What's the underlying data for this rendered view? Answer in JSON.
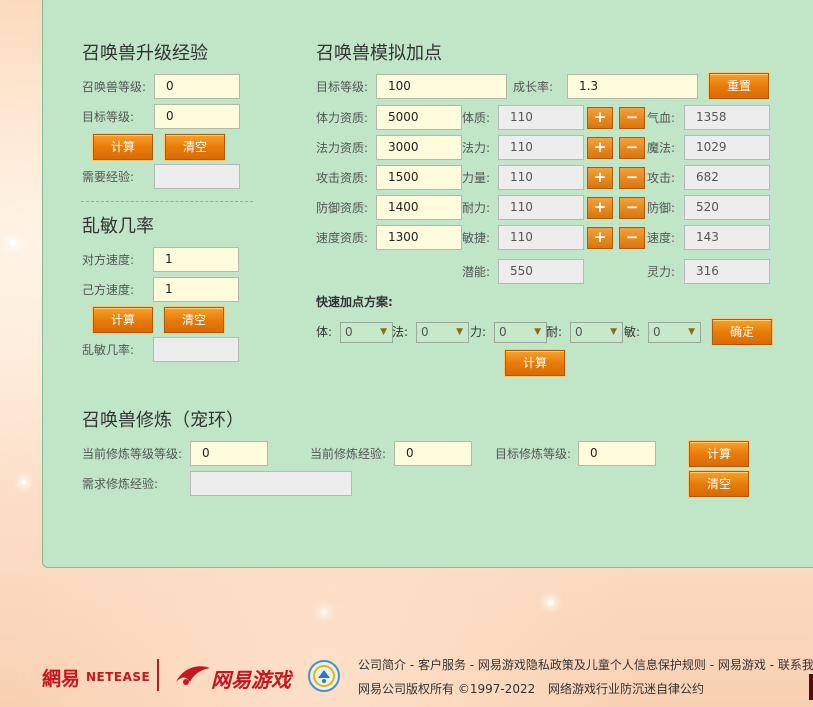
{
  "upgrade": {
    "title": "召唤兽升级经验",
    "cur_level_label": "召唤兽等级:",
    "cur_level_value": "0",
    "target_level_label": "目标等级:",
    "target_level_value": "0",
    "calc_label": "计算",
    "clear_label": "清空",
    "need_exp_label": "需要经验:"
  },
  "speed": {
    "title": "乱敏几率",
    "enemy_label": "对方速度:",
    "enemy_value": "1",
    "own_label": "己方速度:",
    "own_value": "1",
    "calc_label": "计算",
    "clear_label": "清空",
    "rate_label": "乱敏几率:"
  },
  "sim": {
    "title": "召唤兽模拟加点",
    "target_level_label": "目标等级:",
    "target_level_value": "100",
    "growth_label": "成长率:",
    "growth_value": "1.3",
    "reset_label": "重置",
    "rows": [
      {
        "apt_label": "体力资质:",
        "apt_value": "5000",
        "attr_label": "体质:",
        "attr_value": "110",
        "res_label": "气血:",
        "res_value": "1358"
      },
      {
        "apt_label": "法力资质:",
        "apt_value": "3000",
        "attr_label": "法力:",
        "attr_value": "110",
        "res_label": "魔法:",
        "res_value": "1029"
      },
      {
        "apt_label": "攻击资质:",
        "apt_value": "1500",
        "attr_label": "力量:",
        "attr_value": "110",
        "res_label": "攻击:",
        "res_value": "682"
      },
      {
        "apt_label": "防御资质:",
        "apt_value": "1400",
        "attr_label": "耐力:",
        "attr_value": "110",
        "res_label": "防御:",
        "res_value": "520"
      },
      {
        "apt_label": "速度资质:",
        "apt_value": "1300",
        "attr_label": "敏捷:",
        "attr_value": "110",
        "res_label": "速度:",
        "res_value": "143"
      }
    ],
    "plus": "+",
    "minus": "−",
    "potential_label": "潜能:",
    "potential_value": "550",
    "spirit_label": "灵力:",
    "spirit_value": "316",
    "quick_title": "快速加点方案:",
    "quick": [
      {
        "label": "体:",
        "value": "0"
      },
      {
        "label": "法:",
        "value": "0"
      },
      {
        "label": "力:",
        "value": "0"
      },
      {
        "label": "耐:",
        "value": "0"
      },
      {
        "label": "敏:",
        "value": "0"
      }
    ],
    "confirm_label": "确定",
    "calc_label": "计算"
  },
  "train": {
    "title": "召唤兽修炼（宠环）",
    "cur_level_label": "当前修炼等级等级:",
    "cur_level_value": "0",
    "cur_exp_label": "当前修炼经验:",
    "cur_exp_value": "0",
    "target_label": "目标修炼等级:",
    "target_value": "0",
    "calc_label": "计算",
    "clear_label": "清空",
    "need_label": "需求修炼经验:"
  },
  "footer": {
    "netease_cn": "網易",
    "netease_en": "NETEASE",
    "games_logo": "网易游戏",
    "links": "公司简介 - 客户服务 - 网易游戏隐私政策及儿童个人信息保护规则 - 网易游戏 - 联系我",
    "copyright": "网易公司版权所有 ©1997-2022",
    "pledge": "网络游戏行业防沉迷自律公约"
  },
  "colors": {
    "panel_bg": "#c0e6c7",
    "button": "#e87c0a",
    "input_bg": "#fffbdd",
    "readonly_bg": "#ededed"
  }
}
